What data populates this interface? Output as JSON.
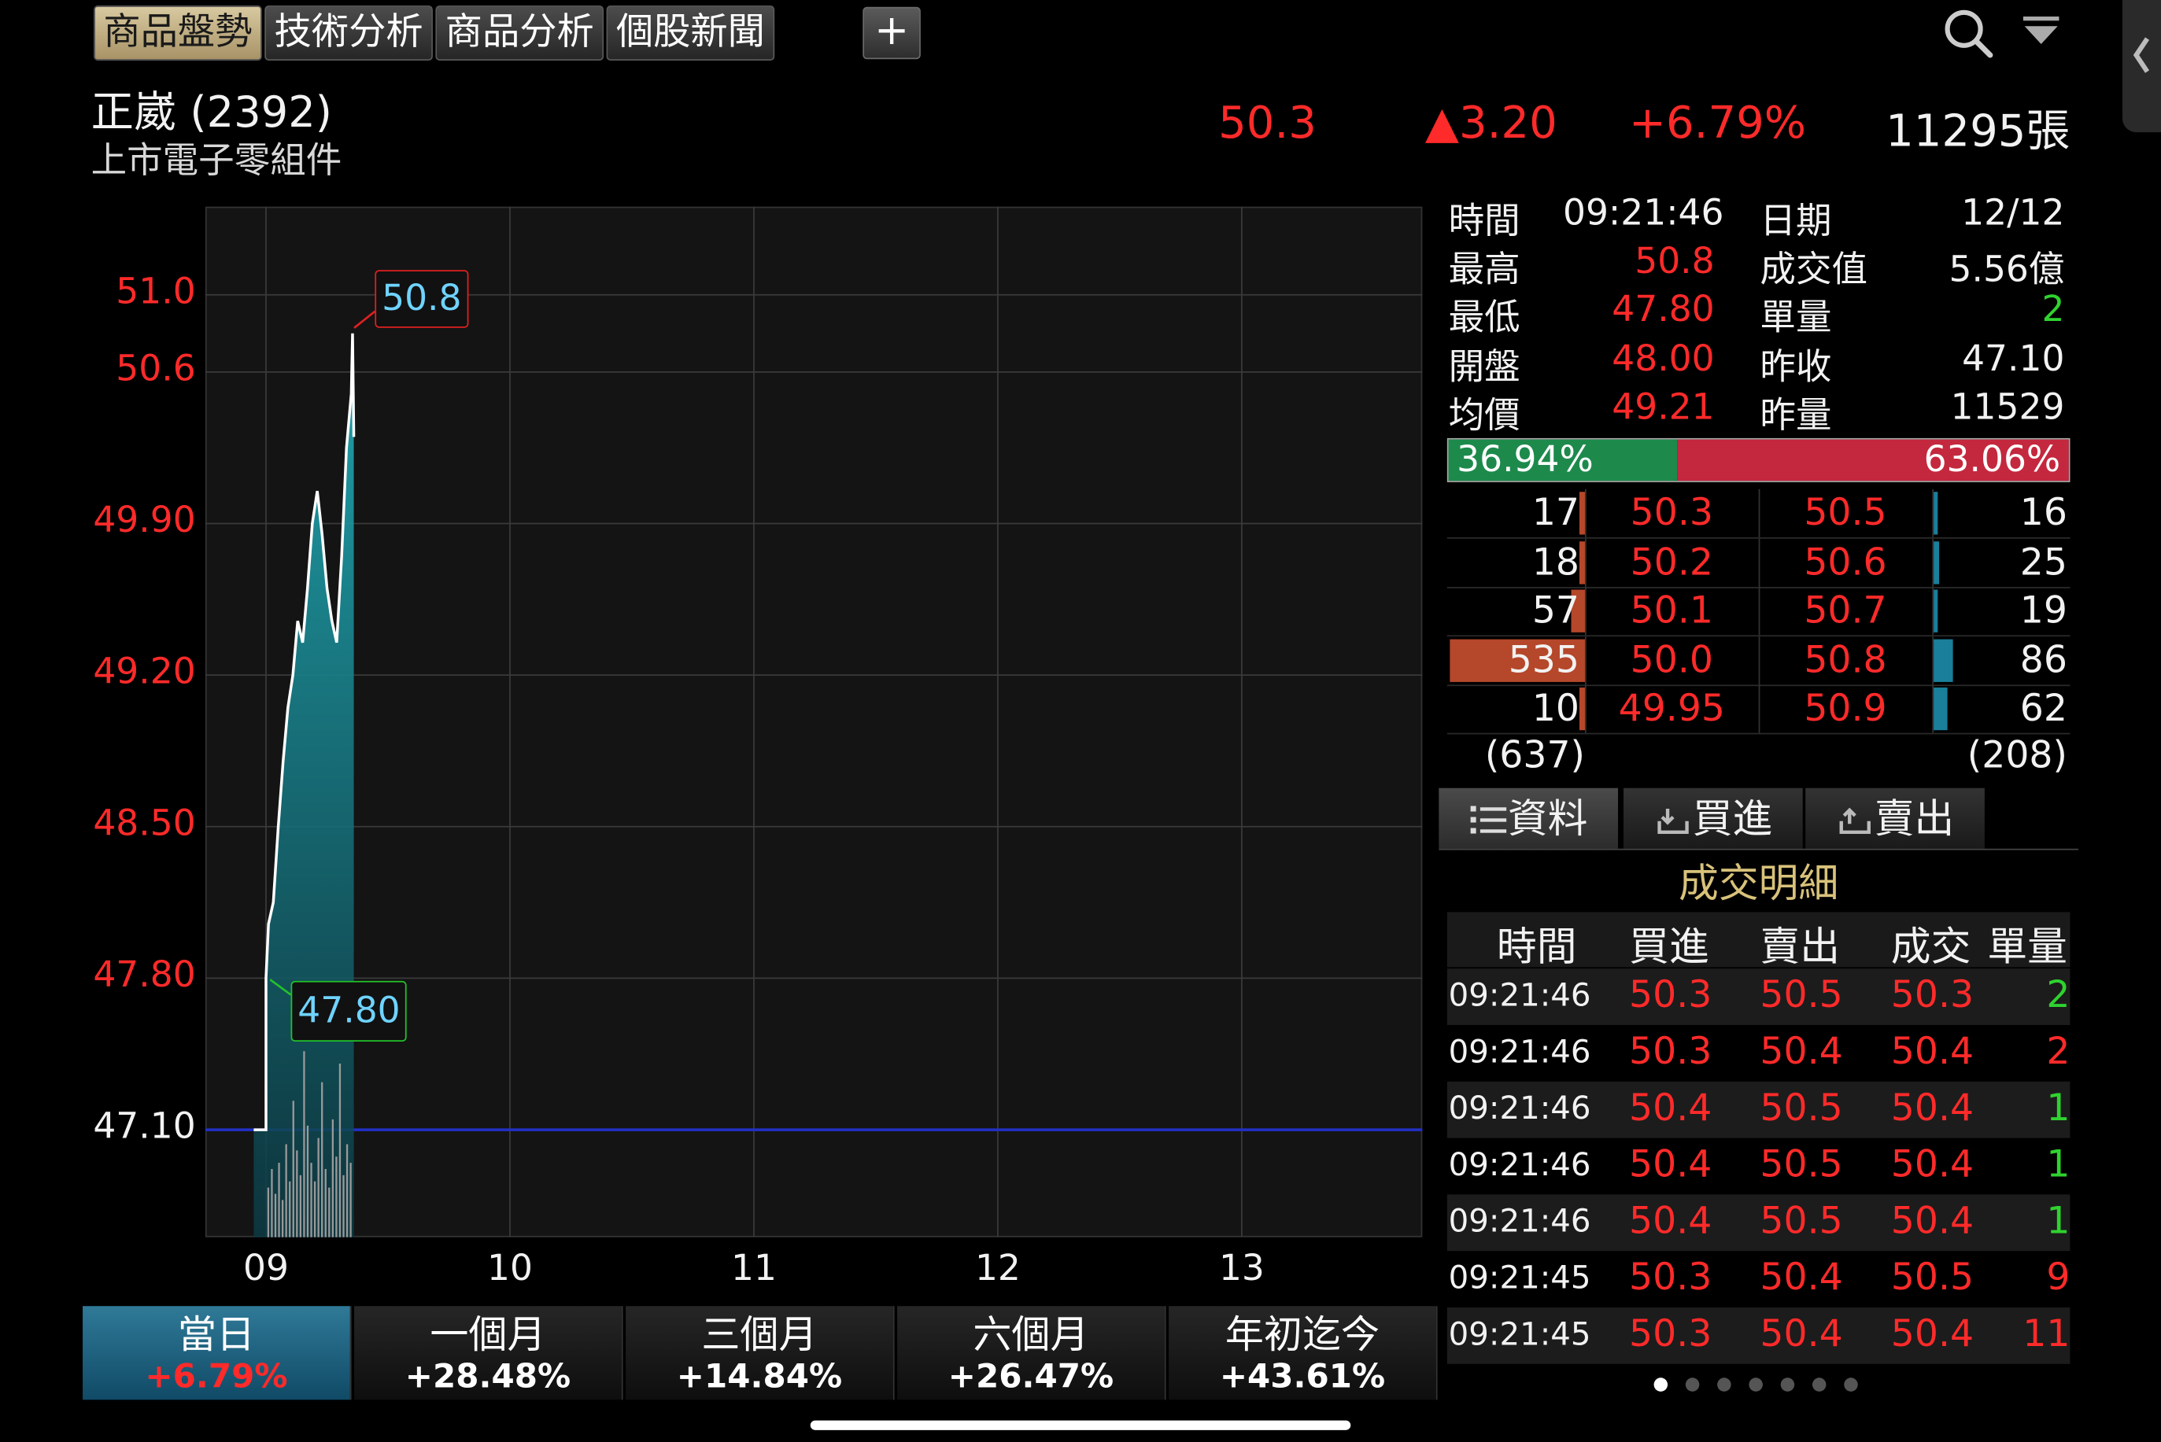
{
  "tabs": [
    "商品盤勢",
    "技術分析",
    "商品分析",
    "個股新聞"
  ],
  "add_tab": "+",
  "header": {
    "name": "正崴 (2392)",
    "category": "上市電子零組件",
    "price": "50.3",
    "change": "▲3.20",
    "change_pct": "+6.79%",
    "volume": "11295張"
  },
  "chart_data": {
    "type": "line",
    "x_ticks": [
      "09",
      "10",
      "11",
      "12",
      "13"
    ],
    "y_ticks": [
      {
        "label": "51.0",
        "value": 51.0
      },
      {
        "label": "50.6",
        "value": 50.6
      },
      {
        "label": "49.90",
        "value": 49.9
      },
      {
        "label": "49.20",
        "value": 49.2
      },
      {
        "label": "48.50",
        "value": 48.5
      },
      {
        "label": "47.80",
        "value": 47.8
      },
      {
        "label": "47.10",
        "value": 47.1
      }
    ],
    "reference_price": 47.1,
    "ylim": [
      46.6,
      51.4
    ],
    "high_label": "50.8",
    "low_label": "47.80",
    "series": [
      {
        "time": 8.95,
        "price": 47.1
      },
      {
        "time": 9.0,
        "price": 47.1
      },
      {
        "time": 9.0,
        "price": 47.8
      },
      {
        "time": 9.01,
        "price": 48.05
      },
      {
        "time": 9.03,
        "price": 48.15
      },
      {
        "time": 9.05,
        "price": 48.5
      },
      {
        "time": 9.07,
        "price": 48.8
      },
      {
        "time": 9.09,
        "price": 49.05
      },
      {
        "time": 9.11,
        "price": 49.2
      },
      {
        "time": 9.13,
        "price": 49.45
      },
      {
        "time": 9.15,
        "price": 49.35
      },
      {
        "time": 9.17,
        "price": 49.6
      },
      {
        "time": 9.19,
        "price": 49.9
      },
      {
        "time": 9.21,
        "price": 50.05
      },
      {
        "time": 9.23,
        "price": 49.85
      },
      {
        "time": 9.25,
        "price": 49.6
      },
      {
        "time": 9.27,
        "price": 49.45
      },
      {
        "time": 9.29,
        "price": 49.35
      },
      {
        "time": 9.31,
        "price": 49.75
      },
      {
        "time": 9.33,
        "price": 50.25
      },
      {
        "time": 9.35,
        "price": 50.5
      },
      {
        "time": 9.355,
        "price": 50.8
      },
      {
        "time": 9.36,
        "price": 50.3
      }
    ],
    "volume_bars": [
      8,
      11,
      7,
      12,
      6,
      15,
      9,
      22,
      14,
      10,
      30,
      18,
      12,
      9,
      16,
      25,
      11,
      8,
      19,
      13,
      28,
      10,
      15,
      12
    ]
  },
  "quote": {
    "time_label": "時間",
    "time": "09:21:46",
    "date_label": "日期",
    "date": "12/12",
    "high_label": "最高",
    "high": "50.8",
    "amount_label": "成交值",
    "amount": "5.56億",
    "low_label": "最低",
    "low": "47.80",
    "unit_vol_label": "單量",
    "unit_vol": "2",
    "open_label": "開盤",
    "open": "48.00",
    "prev_close_label": "昨收",
    "prev_close": "47.10",
    "avg_label": "均價",
    "avg": "49.21",
    "prev_vol_label": "昨量",
    "prev_vol": "11529"
  },
  "ratio": {
    "left": "36.94%",
    "right": "63.06%",
    "left_value": 36.94
  },
  "order_book": [
    {
      "bid_vol": "17",
      "bid": "50.3",
      "ask": "50.5",
      "ask_vol": "16",
      "bid_vol_num": 17,
      "ask_vol_num": 16
    },
    {
      "bid_vol": "18",
      "bid": "50.2",
      "ask": "50.6",
      "ask_vol": "25",
      "bid_vol_num": 18,
      "ask_vol_num": 25
    },
    {
      "bid_vol": "57",
      "bid": "50.1",
      "ask": "50.7",
      "ask_vol": "19",
      "bid_vol_num": 57,
      "ask_vol_num": 19
    },
    {
      "bid_vol": "535",
      "bid": "50.0",
      "ask": "50.8",
      "ask_vol": "86",
      "bid_vol_num": 535,
      "ask_vol_num": 86
    },
    {
      "bid_vol": "10",
      "bid": "49.95",
      "ask": "50.9",
      "ask_vol": "62",
      "bid_vol_num": 10,
      "ask_vol_num": 62
    }
  ],
  "order_totals": {
    "bid": "(637)",
    "ask": "(208)"
  },
  "sub_tabs": [
    "資料",
    "買進",
    "賣出"
  ],
  "trades": {
    "title": "成交明細",
    "headers": [
      "時間",
      "買進",
      "賣出",
      "成交",
      "單量"
    ],
    "rows": [
      {
        "time": "09:21:46",
        "bid": "50.3",
        "ask": "50.5",
        "price": "50.3",
        "vol": "2",
        "vol_color": "green"
      },
      {
        "time": "09:21:46",
        "bid": "50.3",
        "ask": "50.4",
        "price": "50.4",
        "vol": "2",
        "vol_color": "red"
      },
      {
        "time": "09:21:46",
        "bid": "50.4",
        "ask": "50.5",
        "price": "50.4",
        "vol": "1",
        "vol_color": "green"
      },
      {
        "time": "09:21:46",
        "bid": "50.4",
        "ask": "50.5",
        "price": "50.4",
        "vol": "1",
        "vol_color": "green"
      },
      {
        "time": "09:21:46",
        "bid": "50.4",
        "ask": "50.5",
        "price": "50.4",
        "vol": "1",
        "vol_color": "green"
      },
      {
        "time": "09:21:45",
        "bid": "50.3",
        "ask": "50.4",
        "price": "50.5",
        "vol": "9",
        "vol_color": "red"
      },
      {
        "time": "09:21:45",
        "bid": "50.3",
        "ask": "50.4",
        "price": "50.4",
        "vol": "11",
        "vol_color": "red"
      }
    ]
  },
  "periods": [
    {
      "label": "當日",
      "pct": "+6.79%"
    },
    {
      "label": "一個月",
      "pct": "+28.48%"
    },
    {
      "label": "三個月",
      "pct": "+14.84%"
    },
    {
      "label": "六個月",
      "pct": "+26.47%"
    },
    {
      "label": "年初迄今",
      "pct": "+43.61%"
    }
  ],
  "page_dots": 7
}
